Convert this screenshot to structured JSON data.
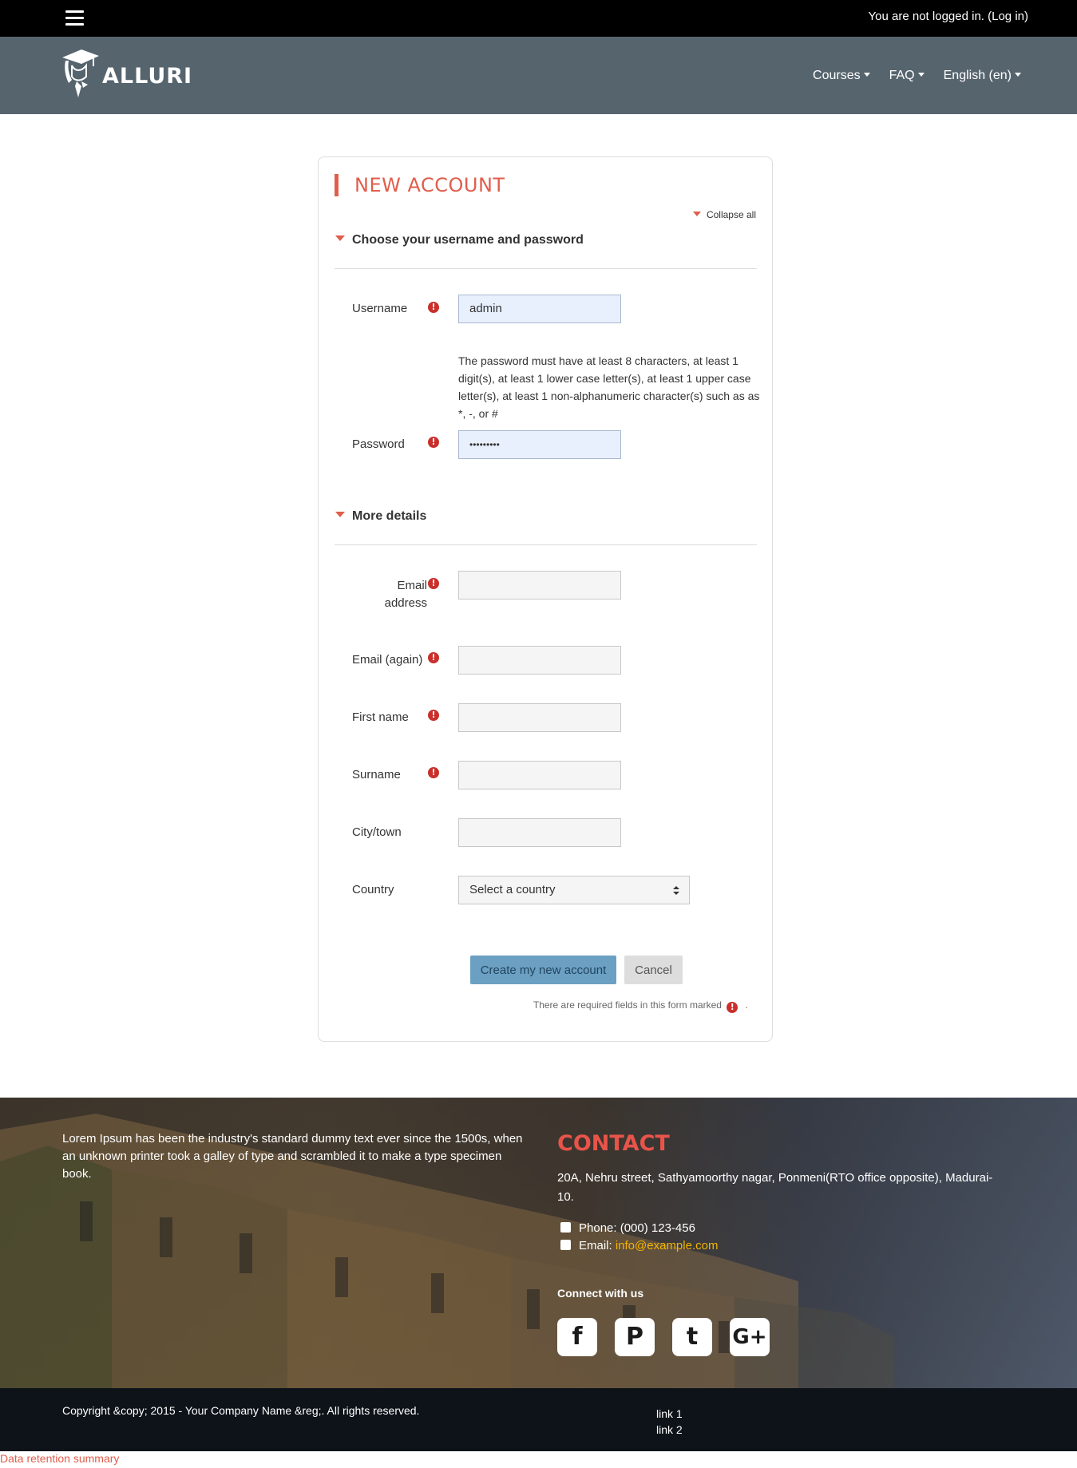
{
  "topbar": {
    "login_text": "You are not logged in. (",
    "login_link": "Log in",
    "login_close": ")"
  },
  "navbar": {
    "logo_text": "ALLURI",
    "menu": [
      {
        "label": "Courses"
      },
      {
        "label": "FAQ"
      },
      {
        "label": "English (en)"
      }
    ]
  },
  "form": {
    "title": "NEW ACCOUNT",
    "collapse_all": "Collapse all",
    "section1": "Choose your username and password",
    "username_label": "Username",
    "username_value": "admin",
    "password_help": "The password must have at least 8 characters, at least 1 digit(s), at least 1 lower case letter(s), at least 1 upper case letter(s), at least 1 non-alphanumeric character(s) such as as *, -, or #",
    "password_label": "Password",
    "password_value": "•••••••••",
    "section2": "More details",
    "email_label": "Email address",
    "email_again_label": "Email (again)",
    "firstname_label": "First name",
    "surname_label": "Surname",
    "city_label": "City/town",
    "country_label": "Country",
    "country_selected": "Select a country",
    "submit_label": "Create my new account",
    "cancel_label": "Cancel",
    "required_note": "There are required fields in this form marked",
    "required_note_end": "."
  },
  "footer": {
    "about": "Lorem Ipsum has been the industry's standard dummy text ever since the 1500s, when an unknown printer took a galley of type and scrambled it to make a type specimen book.",
    "contact_title": "CONTACT",
    "address": "20A, Nehru street, Sathyamoorthy nagar, Ponmeni(RTO office opposite), Madurai-10.",
    "phone": "Phone: (000) 123-456",
    "email_prefix": "Email: ",
    "email": "info@example.com",
    "connect": "Connect with us",
    "social": [
      {
        "name": "facebook",
        "glyph": "f"
      },
      {
        "name": "pinterest",
        "glyph": "P"
      },
      {
        "name": "twitter",
        "glyph": "t"
      },
      {
        "name": "google-plus",
        "glyph": "G+"
      }
    ],
    "copyright": "Copyright &copy; 2015 - Your Company Name &reg;. All rights reserved.",
    "links": [
      "link 1",
      "link 2"
    ]
  },
  "data_retention": "Data retention summary",
  "colors": {
    "accent": "#e05e4c",
    "topbar": "#000000",
    "navbar": "#56646e",
    "primary_button": "#6ba0c3",
    "required": "#c9302c"
  }
}
